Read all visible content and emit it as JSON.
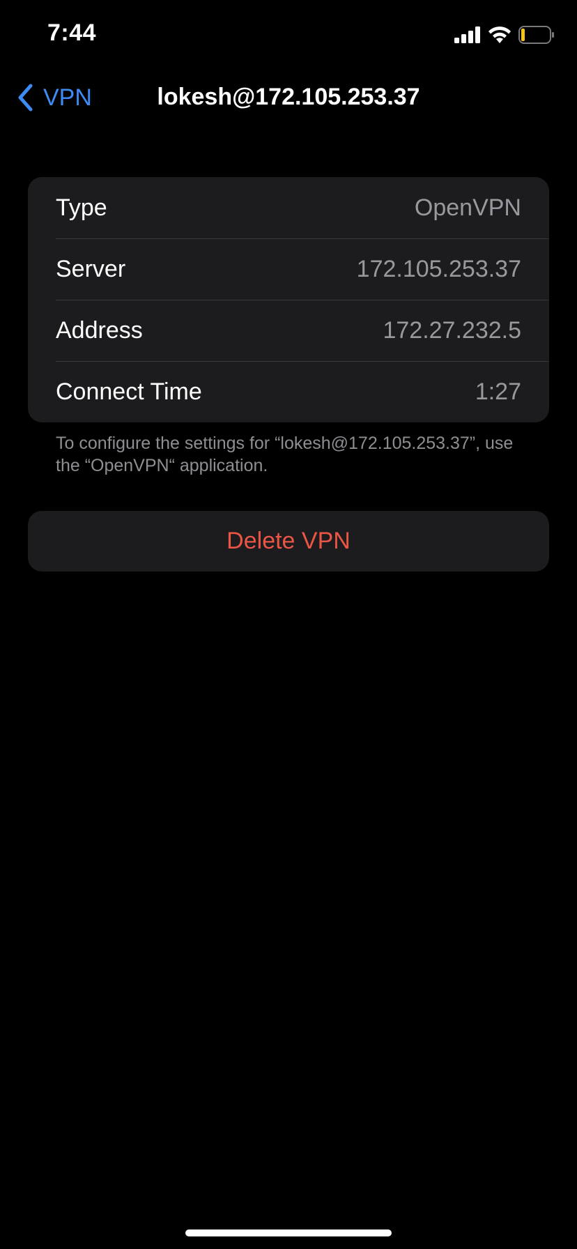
{
  "status_bar": {
    "time": "7:44",
    "icons": [
      "signal-icon",
      "wifi-icon",
      "battery-icon"
    ],
    "battery_color": "#f5c518"
  },
  "nav": {
    "back_label": "VPN",
    "back_icon": "chevron-left-icon",
    "title": "lokesh@172.105.253.37"
  },
  "info": {
    "rows": [
      {
        "label": "Type",
        "value": "OpenVPN"
      },
      {
        "label": "Server",
        "value": "172.105.253.37"
      },
      {
        "label": "Address",
        "value": "172.27.232.5"
      },
      {
        "label": "Connect Time",
        "value": "1:27"
      }
    ]
  },
  "footer_note": "To configure the settings for “lokesh@172.105.253.37”, use the “OpenVPN“ application.",
  "delete_button": {
    "label": "Delete VPN"
  },
  "colors": {
    "background": "#000000",
    "group_background": "#1c1c1e",
    "accent": "#3d8bf5",
    "destructive": "#eb5545",
    "secondary_text": "#98989f"
  }
}
